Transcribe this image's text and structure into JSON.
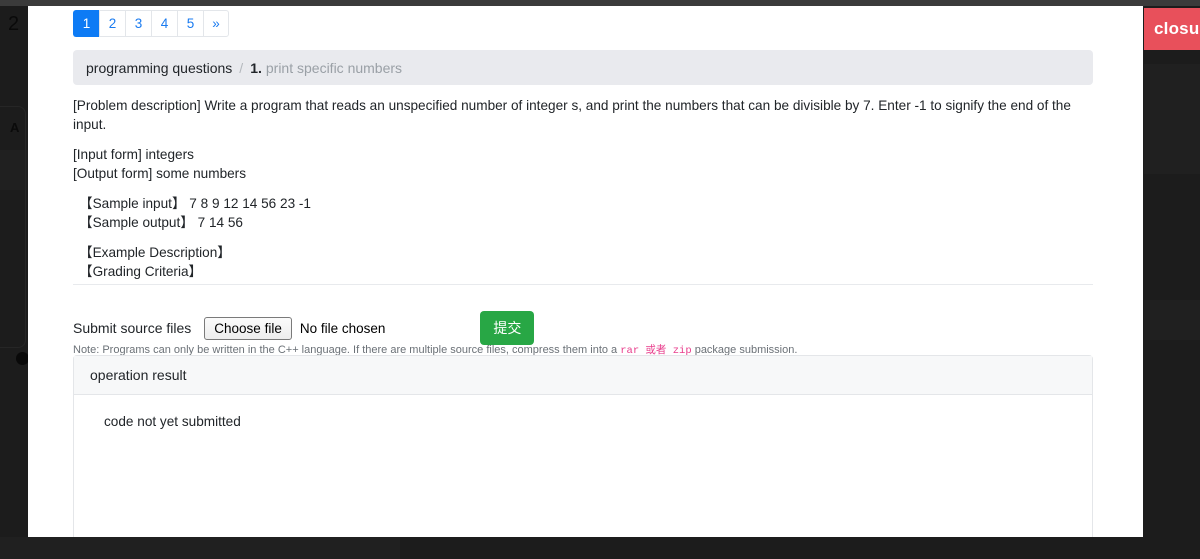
{
  "backdrop": {
    "partial_texts": {
      "left_number": "2",
      "left_letter": "A"
    },
    "ribbon_label": "closure",
    "ribbon_color": "#e8505b"
  },
  "pagination": {
    "pages": [
      {
        "label": "1",
        "active": true
      },
      {
        "label": "2",
        "active": false
      },
      {
        "label": "3",
        "active": false
      },
      {
        "label": "4",
        "active": false
      },
      {
        "label": "5",
        "active": false
      },
      {
        "label": "»",
        "active": false
      }
    ],
    "active_color": "#0d7bf5",
    "link_color": "#1a7bf0"
  },
  "breadcrumb": {
    "root": "programming questions",
    "separator": "/",
    "number": "1.",
    "title": "print specific numbers"
  },
  "problem": {
    "description": "[Problem description] Write a program that reads an  unspecified number of integer s, and print the numbers that can be divisible by 7. Enter -1 to signify the end of the input.",
    "input_form": "[Input form] integers",
    "output_form": "[Output form] some numbers",
    "sample_input": "【Sample input】 7 8 9 12 14 56 23 -1",
    "sample_output": "【Sample output】 7 14 56",
    "example_description": "【Example Description】",
    "grading_criteria": "【Grading Criteria】"
  },
  "submit": {
    "label": "Submit source files",
    "choose_file_button": "Choose file",
    "file_status": "No file chosen",
    "submit_button": "提交",
    "submit_button_color": "#28a745",
    "note_prefix": "Note: Programs can only be written in the C++ language. If there are multiple source files, compress them into a ",
    "note_code": "rar 或者 zip",
    "note_suffix": " package submission.",
    "note_code_color": "#e83e8c"
  },
  "result": {
    "header": "operation result",
    "body": "code not yet submitted"
  }
}
